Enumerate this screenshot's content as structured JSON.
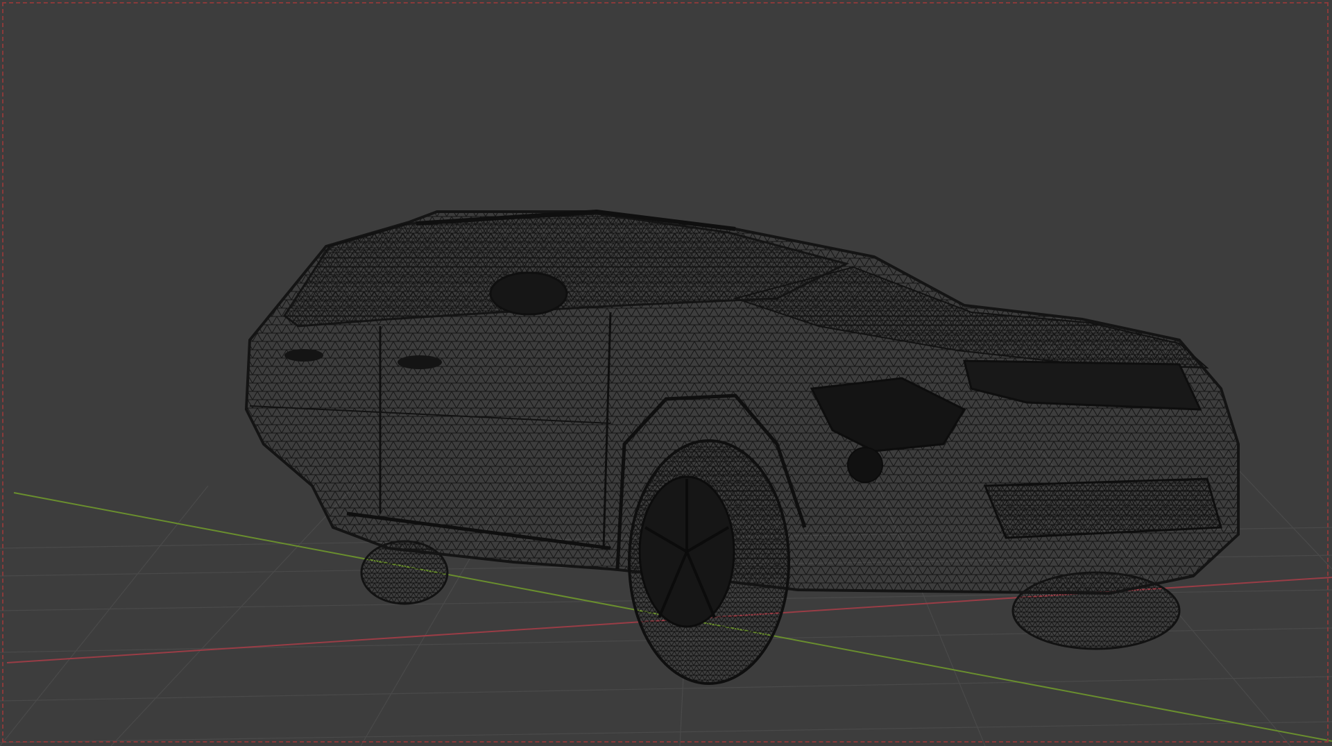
{
  "app": {
    "view": "3D Viewport",
    "shading": "wireframe",
    "background_color": "#3d3d3d",
    "grid_color": "#4a4a4a",
    "axis_x_color": "#9a3d46",
    "axis_y_color": "#6a8f2e",
    "wire_color": "#161616",
    "camera_frame_color": "#8a3a3a"
  },
  "scene": {
    "object": "suv-wireframe-model",
    "object_icon": "car-wireframe"
  }
}
